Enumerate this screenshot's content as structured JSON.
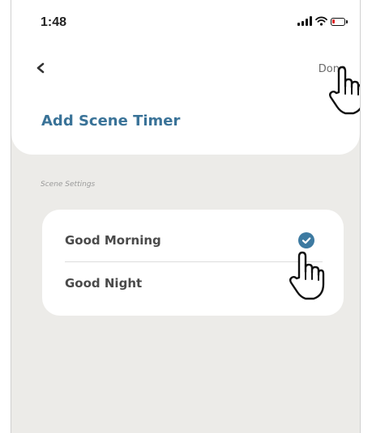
{
  "status_bar": {
    "time": "1:48"
  },
  "nav": {
    "done_label": "Done"
  },
  "page": {
    "title": "Add Scene Timer"
  },
  "section": {
    "label": "Scene Settings"
  },
  "scenes": [
    {
      "label": "Good Morning",
      "selected": true
    },
    {
      "label": "Good Night",
      "selected": false
    }
  ],
  "colors": {
    "accent": "#3d7aa1",
    "title": "#3a7398",
    "background": "#ecebe8",
    "battery_low": "#e02424"
  },
  "icons": [
    "back-chevron-icon",
    "signal-icon",
    "wifi-icon",
    "battery-icon",
    "checkmark-icon",
    "hand-pointer-icon"
  ]
}
